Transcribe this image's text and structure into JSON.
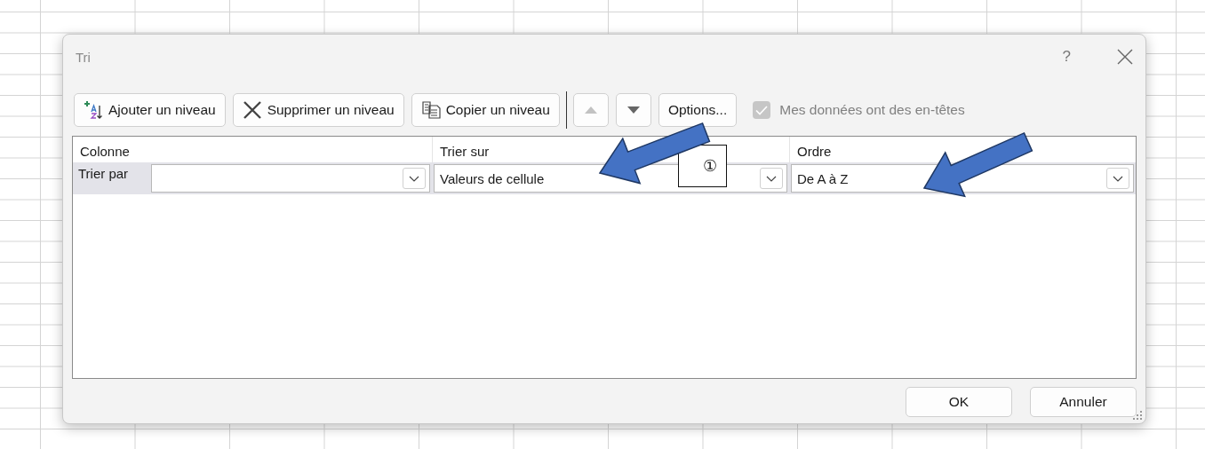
{
  "dialog": {
    "title": "Tri",
    "help": "?"
  },
  "toolbar": [
    {
      "kind": "add",
      "label": "Ajouter un niveau",
      "disabled": false
    },
    {
      "kind": "delete",
      "label": "Supprimer un niveau",
      "disabled": false
    },
    {
      "kind": "copy",
      "label": "Copier un niveau",
      "disabled": false
    },
    {
      "kind": "up",
      "disabled": true
    },
    {
      "kind": "down",
      "disabled": false
    },
    {
      "kind": "options",
      "label": "Options...",
      "disabled": false
    }
  ],
  "headers_checkbox": {
    "label": "Mes données ont des en-têtes",
    "checked": true,
    "disabled": true
  },
  "table": {
    "columns": [
      "Colonne",
      "Trier sur",
      "Ordre"
    ],
    "rows": [
      {
        "label": "Trier par",
        "sort_on": "Valeurs de cellule",
        "order": "De A à Z"
      }
    ]
  },
  "callout": "①",
  "buttons": [
    "OK",
    "Annuler"
  ]
}
